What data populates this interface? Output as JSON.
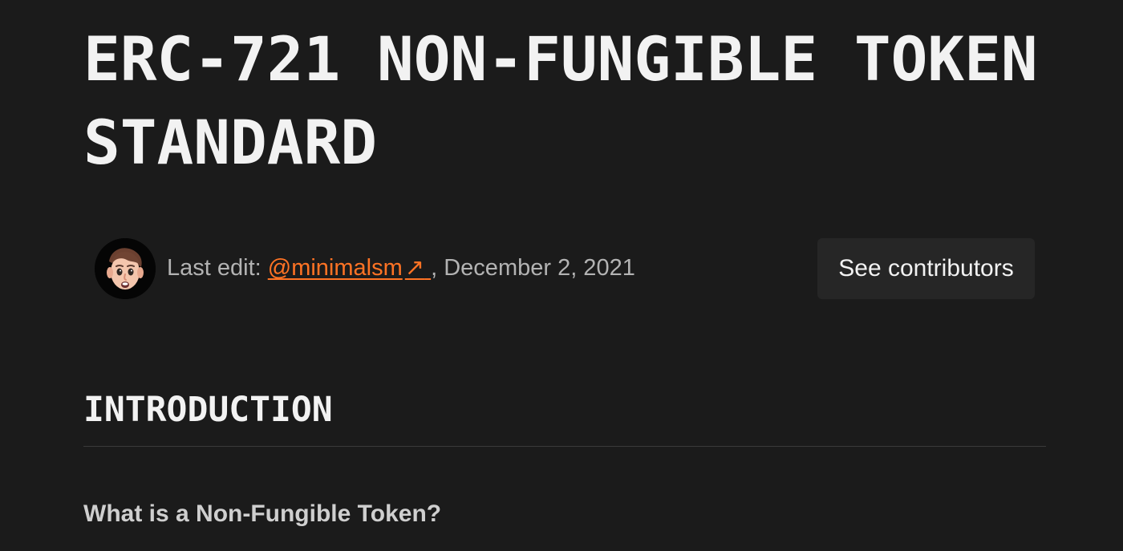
{
  "page": {
    "title": "ERC-721 NON-FUNGIBLE TOKEN STANDARD"
  },
  "meta": {
    "avatar_icon": "memoji-avatar-icon",
    "last_edit_label": "Last edit:",
    "author_link": "@minimalsm",
    "external_link_icon": "↗",
    "separator_date": ", December 2, 2021",
    "contributors_button": "See contributors"
  },
  "content": {
    "section_heading": "INTRODUCTION",
    "subheading": "What is a Non-Fungible Token?"
  },
  "colors": {
    "background": "#1b1b1b",
    "text": "#f2f2f2",
    "muted_text": "#b3b3b3",
    "link": "#ff7324",
    "button_background": "#262626"
  }
}
